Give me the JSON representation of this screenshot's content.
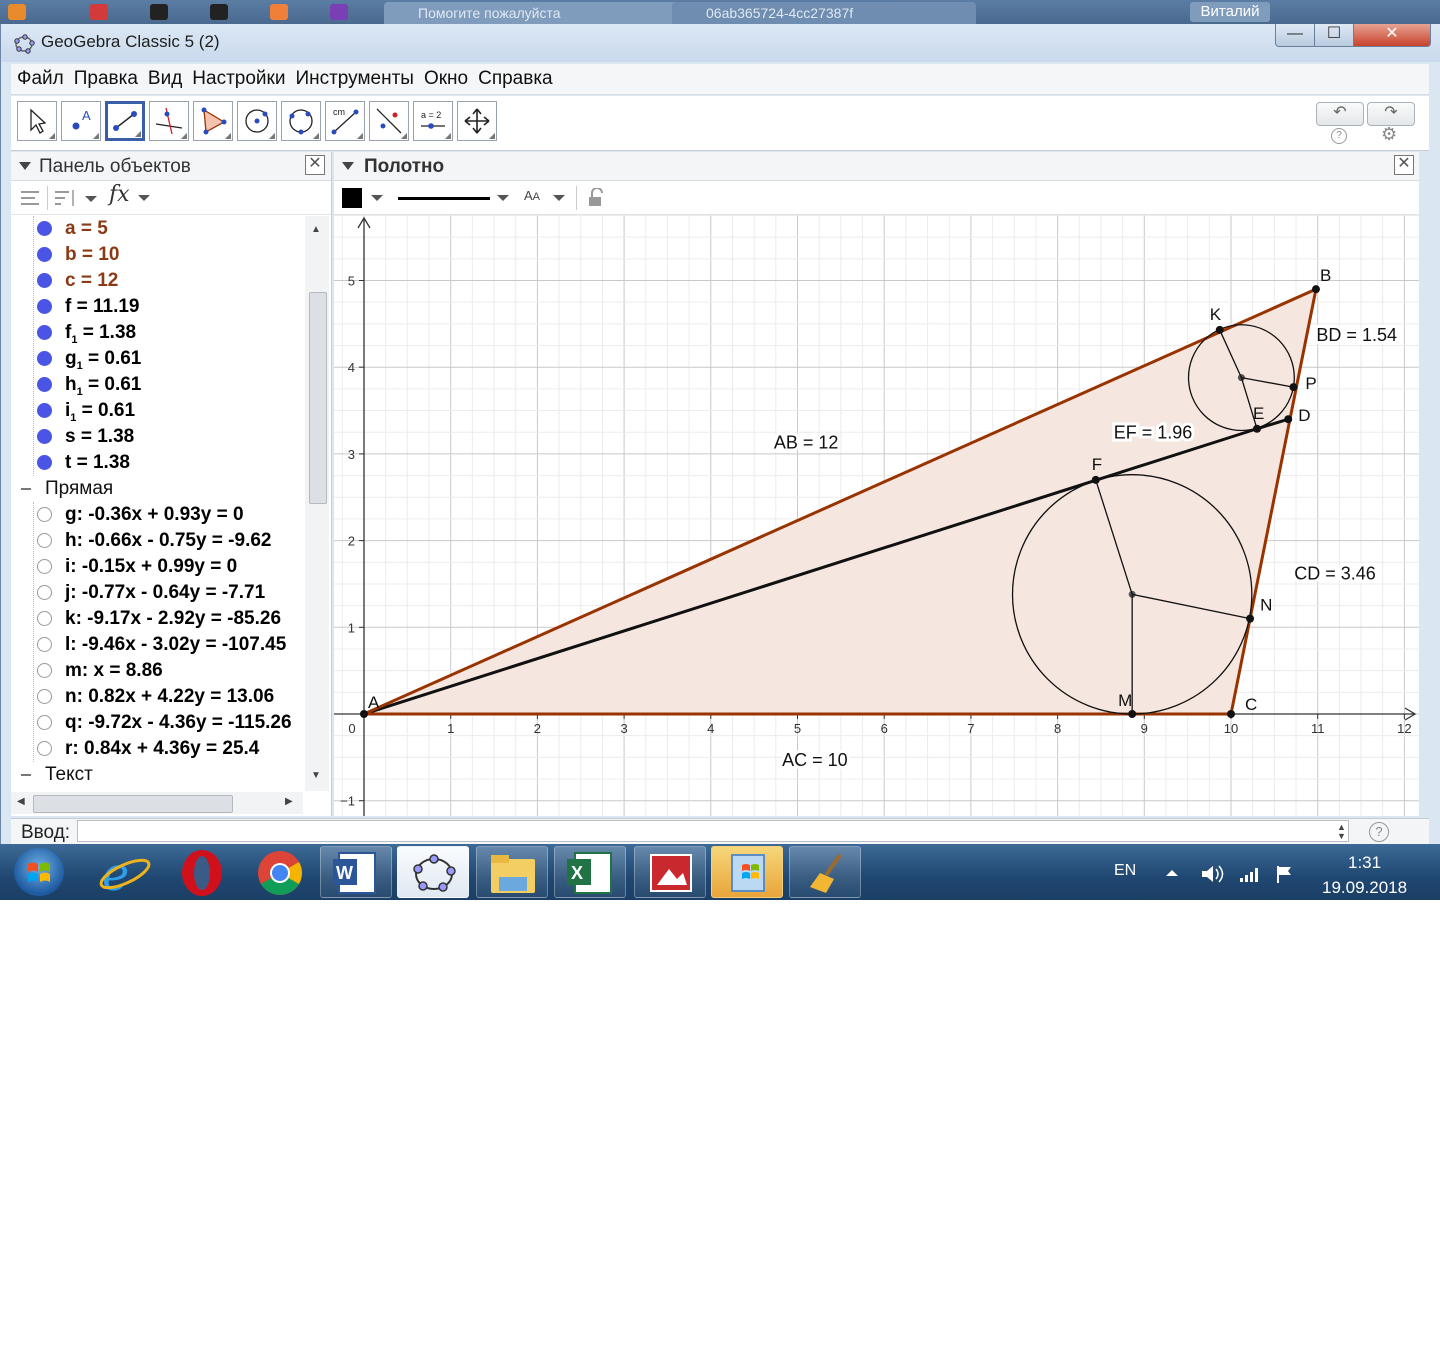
{
  "window": {
    "title": "GeoGebra Classic 5 (2)",
    "user": "Виталий"
  },
  "browser_tabs": [
    "Помогите пожалуйста",
    "06ab365724-4cc27387f"
  ],
  "menu": [
    "Файл",
    "Правка",
    "Вид",
    "Настройки",
    "Инструменты",
    "Окно",
    "Справка"
  ],
  "toolbar": {
    "tools": [
      "move-tool-icon",
      "point-tool-icon",
      "segment-tool-icon",
      "perpendicular-line-tool-icon",
      "polygon-tool-icon",
      "circle-center-point-tool-icon",
      "circle-three-points-tool-icon",
      "distance-tool-icon",
      "reflect-tool-icon",
      "slider-tool-icon",
      "move-graphics-tool-icon"
    ],
    "slider_tool_label": "a = 2",
    "distance_tool_label": "cm",
    "active_tool": 2
  },
  "algebra": {
    "title": "Панель объектов",
    "rows": [
      {
        "name": "a",
        "sub": "",
        "value": " = 5",
        "color": "brown",
        "filled": true
      },
      {
        "name": "b",
        "sub": "",
        "value": " = 10",
        "color": "brown",
        "filled": true
      },
      {
        "name": "c",
        "sub": "",
        "value": " = 12",
        "color": "brown",
        "filled": true
      },
      {
        "name": "f",
        "sub": "",
        "value": " = 11.19",
        "color": "black",
        "filled": true
      },
      {
        "name": "f",
        "sub": "1",
        "value": " = 1.38",
        "color": "black",
        "filled": true
      },
      {
        "name": "g",
        "sub": "1",
        "value": " = 0.61",
        "color": "black",
        "filled": true
      },
      {
        "name": "h",
        "sub": "1",
        "value": " = 0.61",
        "color": "black",
        "filled": true
      },
      {
        "name": "i",
        "sub": "1",
        "value": " = 0.61",
        "color": "black",
        "filled": true
      },
      {
        "name": "s",
        "sub": "",
        "value": " = 1.38",
        "color": "black",
        "filled": true
      },
      {
        "name": "t",
        "sub": "",
        "value": " = 1.38",
        "color": "black",
        "filled": true
      }
    ],
    "category_line": "Прямая",
    "lines": [
      "g: -0.36x + 0.93y = 0",
      "h: -0.66x - 0.75y = -9.62",
      "i: -0.15x + 0.99y = 0",
      "j: -0.77x - 0.64y = -7.71",
      "k: -9.17x - 2.92y = -85.26",
      "l: -9.46x - 3.02y = -107.45",
      "m: x = 8.86",
      "n: 0.82x + 4.22y = 13.06",
      "q: -9.72x - 4.36y = -115.26",
      "r: 0.84x + 4.36y = 25.4"
    ],
    "category_next": "Текст"
  },
  "graphics": {
    "title": "Полотно",
    "x_ticks": [
      0,
      1,
      2,
      3,
      4,
      5,
      6,
      7,
      8,
      9,
      10,
      11,
      12
    ],
    "y_ticks": [
      -1,
      1,
      2,
      3,
      4,
      5
    ],
    "x_range": [
      -0.35,
      12.15
    ],
    "y_range": [
      -1.15,
      5.75
    ],
    "points": [
      {
        "name": "A",
        "x": 0,
        "y": 0
      },
      {
        "name": "B",
        "x": 10.98,
        "y": 4.9
      },
      {
        "name": "C",
        "x": 10,
        "y": 0
      },
      {
        "name": "D",
        "x": 10.66,
        "y": 3.4
      },
      {
        "name": "E",
        "x": 10.3,
        "y": 3.29
      },
      {
        "name": "F",
        "x": 8.44,
        "y": 2.7
      },
      {
        "name": "K",
        "x": 9.87,
        "y": 4.43
      },
      {
        "name": "P",
        "x": 10.72,
        "y": 3.77
      },
      {
        "name": "N",
        "x": 10.22,
        "y": 1.1
      },
      {
        "name": "M",
        "x": 8.86,
        "y": 0
      }
    ],
    "circles": [
      {
        "cx": 8.86,
        "cy": 1.38,
        "r": 1.38
      },
      {
        "cx": 10.12,
        "cy": 3.88,
        "r": 0.61
      }
    ],
    "labels": [
      {
        "text": "AB = 12",
        "x": 5.1,
        "y": 3.06
      },
      {
        "text": "AC = 10",
        "x": 5.2,
        "y": -0.6
      },
      {
        "text": "BD = 1.54",
        "x": 11.45,
        "y": 4.3
      },
      {
        "text": "CD = 3.46",
        "x": 11.2,
        "y": 1.55
      },
      {
        "text": "EF = 1.96",
        "x": 9.1,
        "y": 3.18
      }
    ],
    "colors": {
      "triangle": "#993300",
      "fill": "#f6e6e0",
      "grid": "#e4e4e4",
      "axis": "#333333"
    }
  },
  "input": {
    "label": "Ввод:",
    "value": ""
  },
  "taskbar": {
    "apps": [
      "internet-explorer-icon",
      "opera-icon",
      "chrome-icon",
      "word-icon",
      "geogebra-icon",
      "file-explorer-icon",
      "excel-icon",
      "image-viewer-icon",
      "windows-update-icon",
      "cleaner-icon"
    ],
    "lang": "EN",
    "time": "1:31",
    "date": "19.09.2018"
  }
}
